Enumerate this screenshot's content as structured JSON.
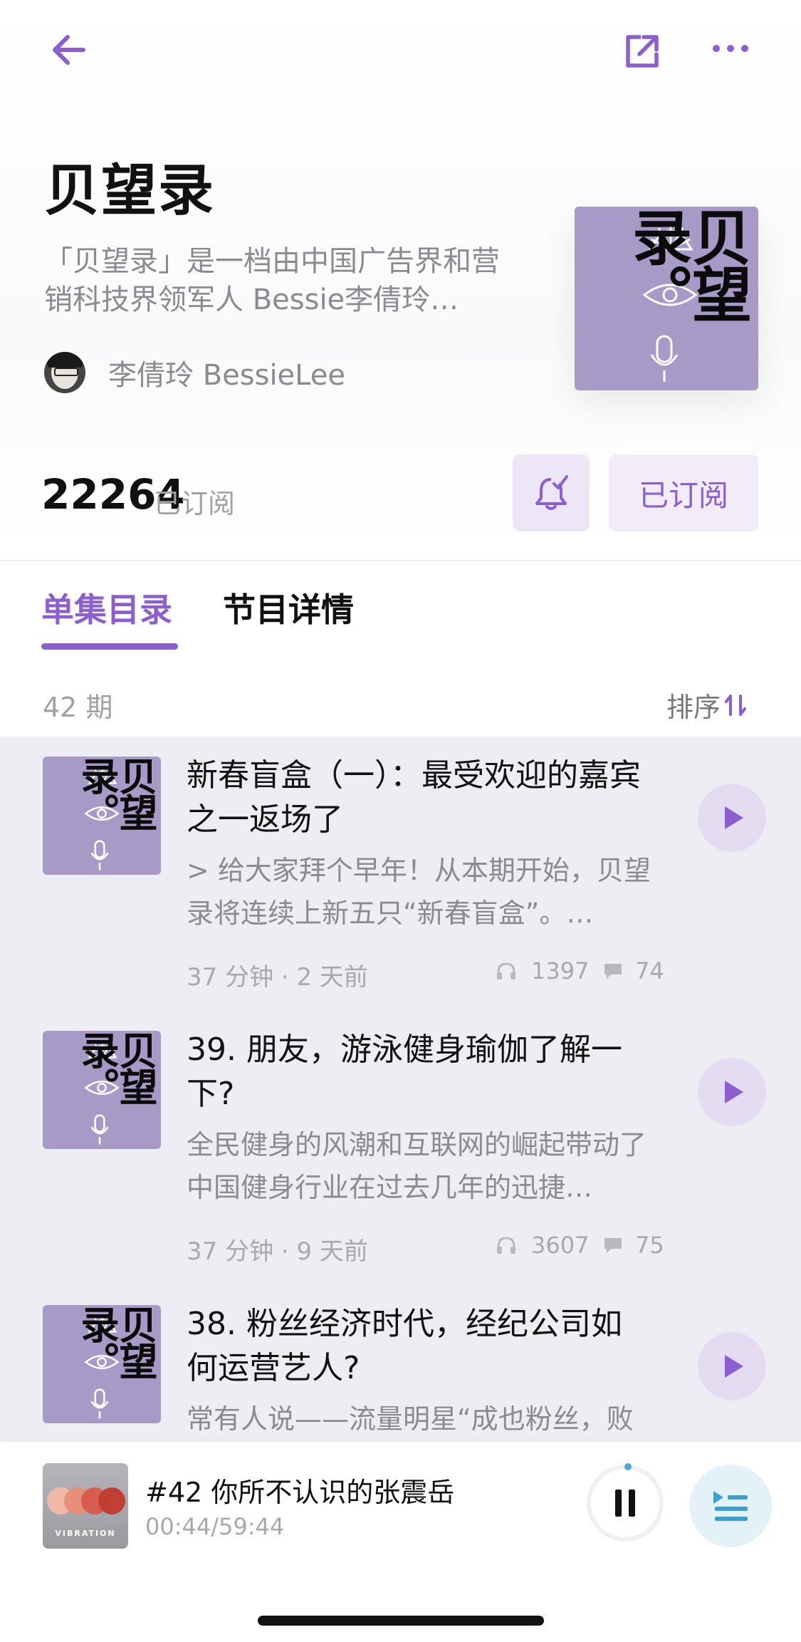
{
  "podcast": {
    "title": "贝望录",
    "description": "「贝望录」是一档由中国广告界和营销科技界领军人 Bessie李倩玲…",
    "author": "李倩玲 BessieLee",
    "cover_text": "贝望录。",
    "subscribers": "22264",
    "subscribers_label": "已订阅",
    "subscribed_button": "已订阅"
  },
  "tabs": [
    {
      "label": "单集目录",
      "active": true
    },
    {
      "label": "节目详情",
      "active": false
    }
  ],
  "list_header": {
    "count": "42 期",
    "sort_label": "排序"
  },
  "episodes": [
    {
      "title": "新春盲盒（一）：最受欢迎的嘉宾之一返场了",
      "description": "> 给大家拜个早年！从本期开始，贝望录将连续上新五只“新春盲盒”。…",
      "meta": "37 分钟 · 2 天前",
      "plays": "1397",
      "comments": "74"
    },
    {
      "title": "39. 朋友，游泳健身瑜伽了解一下?",
      "description": "全民健身的风潮和互联网的崛起带动了中国健身行业在过去几年的迅捷…",
      "meta": "37 分钟 · 9 天前",
      "plays": "3607",
      "comments": "75"
    },
    {
      "title": "38. 粉丝经济时代，经纪公司如何运营艺人?",
      "description": "常有人说——流量明星“成也粉丝，败",
      "meta": "",
      "plays": "",
      "comments": ""
    }
  ],
  "now_playing": {
    "title": "#42 你所不认识的张震岳",
    "time": "00:44/59:44",
    "cover_text": "VIBRATION"
  },
  "icons": {
    "back": "arrow-left-icon",
    "share": "share-icon",
    "more": "more-icon",
    "bell": "bell-icon",
    "sort": "sort-icon",
    "play": "play-icon",
    "pause": "pause-icon",
    "queue": "playlist-icon",
    "headphones": "headphones-icon",
    "comment": "comment-icon"
  },
  "colors": {
    "accent": "#8b5fcf",
    "cover_bg": "#a79ac7",
    "list_bg": "#efedf4"
  }
}
